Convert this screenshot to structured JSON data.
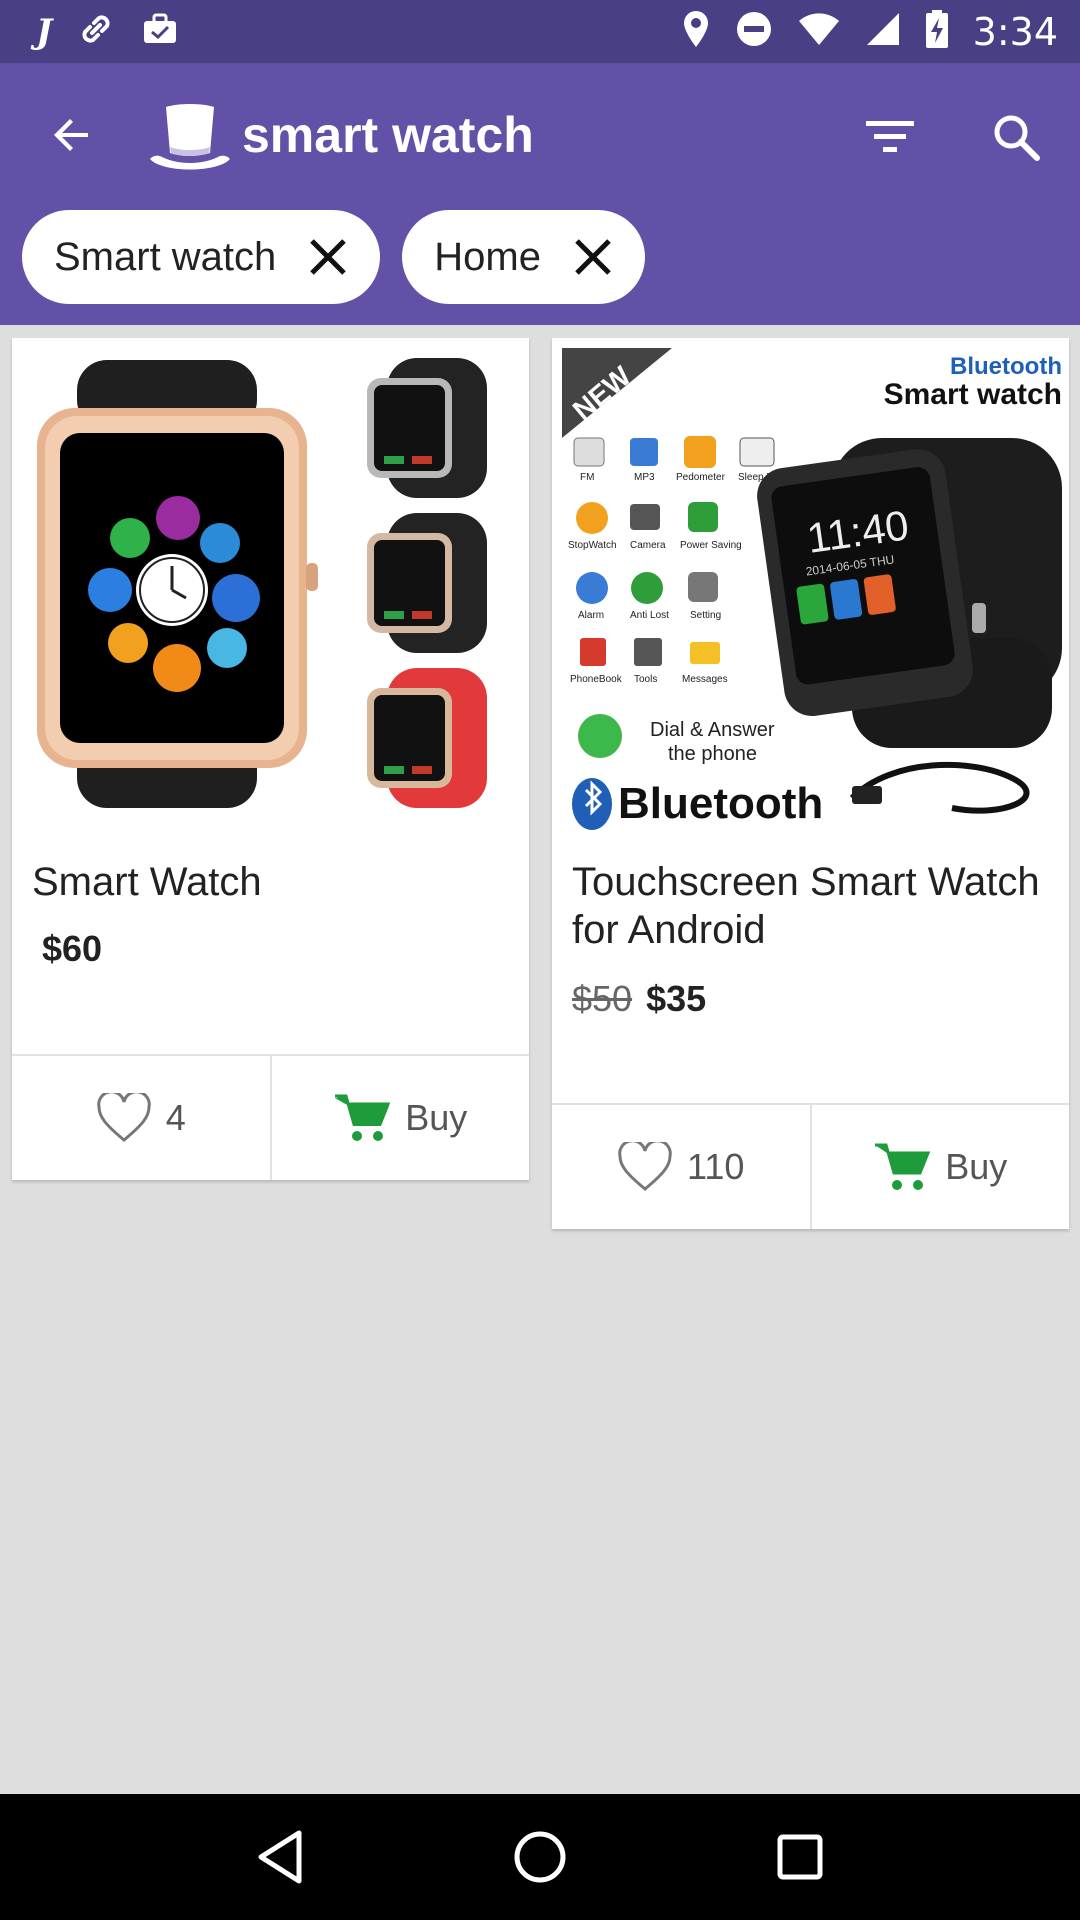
{
  "status_bar": {
    "time": "3:34",
    "left_icons": [
      "j-app-icon",
      "link-icon",
      "briefcase-icon"
    ],
    "right_icons": [
      "location-icon",
      "do-not-disturb-icon",
      "wifi-icon",
      "signal-icon",
      "battery-charging-icon"
    ]
  },
  "toolbar": {
    "title": "smart watch",
    "logo_icon": "top-hat-icon",
    "back_icon": "arrow-back-icon",
    "filter_icon": "filter-icon",
    "search_icon": "search-icon"
  },
  "filters": [
    {
      "label": "Smart watch"
    },
    {
      "label": "Home"
    }
  ],
  "products": [
    {
      "title": "Smart Watch",
      "price": "$60",
      "old_price": "",
      "likes": "4",
      "buy_label": "Buy"
    },
    {
      "title": "Touchscreen Smart Watch for Android",
      "price": "$35",
      "old_price": "$50",
      "likes": "110",
      "buy_label": "Buy",
      "image_text": {
        "badge": "NEW",
        "brand_line1": "Bluetooth",
        "brand_line2": "Smart watch",
        "features": [
          "FM",
          "MP3",
          "Pedometer",
          "Sleep Monitor",
          "StopWatch",
          "Camera",
          "Power Saving",
          "Alarm",
          "Anti Lost",
          "Setting",
          "PhoneBook",
          "Tools",
          "Messages"
        ],
        "dial_line1": "Dial & Answer",
        "dial_line2": "the phone",
        "bluetooth_logo": "Bluetooth",
        "watch_time": "11:40",
        "watch_date": "2014-06-05  THU"
      }
    }
  ],
  "colors": {
    "status_bar": "#483f85",
    "app_bar": "#6351a8",
    "background": "#dedede",
    "cart_green": "#1e9b3b"
  }
}
